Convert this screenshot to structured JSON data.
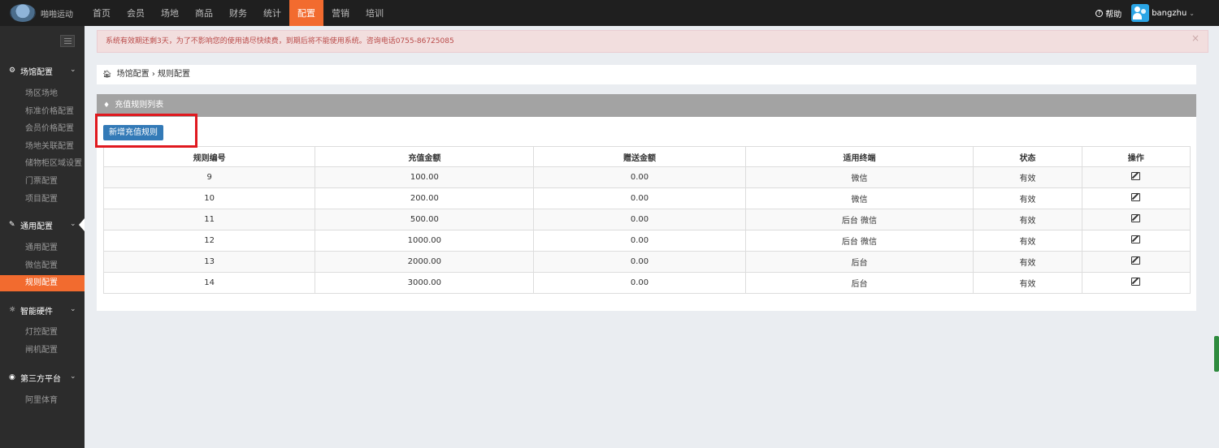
{
  "app": {
    "name": "啪啪运动"
  },
  "nav": {
    "items": [
      "首页",
      "会员",
      "场地",
      "商品",
      "财务",
      "统计",
      "配置",
      "营销",
      "培训"
    ],
    "active_index": 6
  },
  "user": {
    "help_label": "帮助",
    "username": "bangzhu"
  },
  "sidebar": {
    "groups": [
      {
        "label": "场馆配置",
        "icon": "cogs-icon",
        "items": [
          "场区场地",
          "标准价格配置",
          "会员价格配置",
          "场地关联配置",
          "储物柜区域设置",
          "门票配置",
          "项目配置"
        ]
      },
      {
        "label": "通用配置",
        "icon": "wrench-icon",
        "items": [
          "通用配置",
          "微信配置",
          "规则配置"
        ],
        "current": true
      },
      {
        "label": "智能硬件",
        "icon": "gear-icon",
        "items": [
          "灯控配置",
          "闸机配置"
        ]
      },
      {
        "label": "第三方平台",
        "icon": "eye-icon",
        "items": [
          "阿里体育"
        ]
      }
    ],
    "active_item": "规则配置"
  },
  "alert": {
    "message": "系统有效期还剩3天，为了不影响您的使用请尽快续费，到期后将不能使用系统。咨询电话0755-86725085",
    "close": "×"
  },
  "breadcrumb": {
    "parent": "场馆配置",
    "separator": "›",
    "current": "规则配置"
  },
  "panel": {
    "title": "充值规则列表",
    "add_button": "新增充值规则"
  },
  "table": {
    "headers": [
      "规则编号",
      "充值金额",
      "赠送金额",
      "适用终端",
      "状态",
      "操作"
    ],
    "rows": [
      {
        "id": "9",
        "amount": "100.00",
        "bonus": "0.00",
        "terminal": "微信",
        "status": "有效"
      },
      {
        "id": "10",
        "amount": "200.00",
        "bonus": "0.00",
        "terminal": "微信",
        "status": "有效"
      },
      {
        "id": "11",
        "amount": "500.00",
        "bonus": "0.00",
        "terminal": "后台 微信",
        "status": "有效"
      },
      {
        "id": "12",
        "amount": "1000.00",
        "bonus": "0.00",
        "terminal": "后台 微信",
        "status": "有效"
      },
      {
        "id": "13",
        "amount": "2000.00",
        "bonus": "0.00",
        "terminal": "后台",
        "status": "有效"
      },
      {
        "id": "14",
        "amount": "3000.00",
        "bonus": "0.00",
        "terminal": "后台",
        "status": "有效"
      }
    ]
  },
  "colors": {
    "accent": "#f26b2f",
    "primary_button": "#337ab7",
    "highlight_box": "#e0191f",
    "alert_text": "#b94a48"
  }
}
